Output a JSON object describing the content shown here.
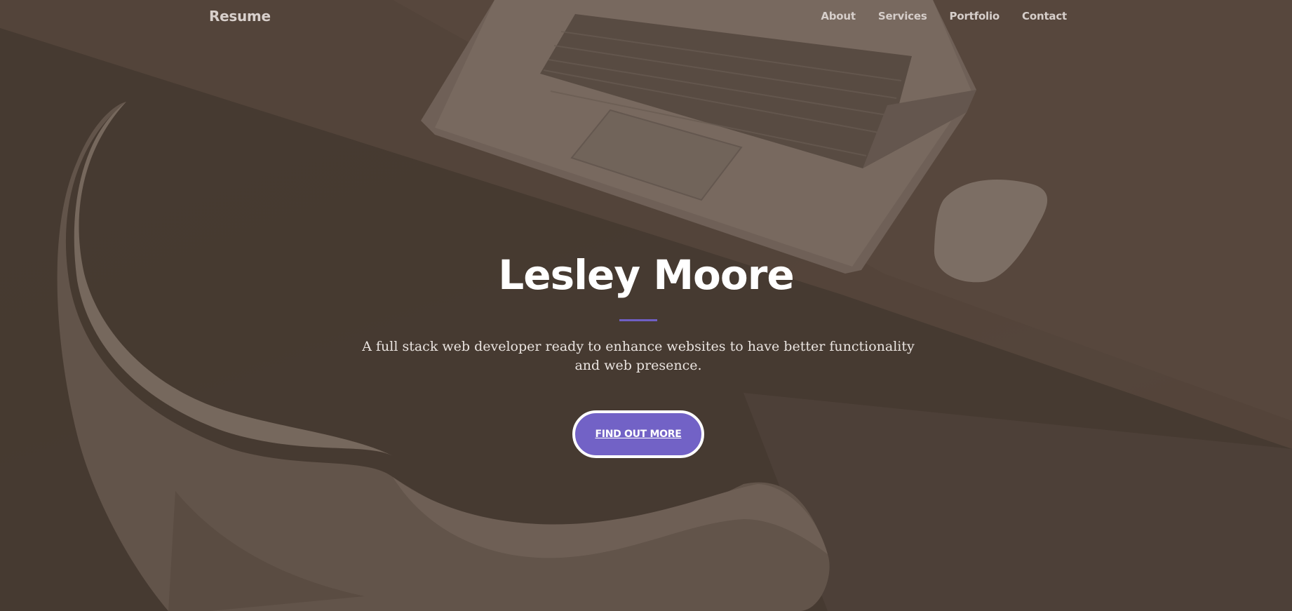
{
  "navbar": {
    "brand": "Resume",
    "links": [
      {
        "label": "About"
      },
      {
        "label": "Services"
      },
      {
        "label": "Portfolio"
      },
      {
        "label": "Contact"
      }
    ]
  },
  "hero": {
    "title": "Lesley Moore",
    "subtitle": "A full stack web developer ready to enhance websites to have better functionality and web presence.",
    "cta_label": "Find Out More"
  },
  "colors": {
    "overlay": "#4d4038",
    "accent": "#7262c6",
    "divider": "#6f5fc4",
    "text": "#ffffff"
  }
}
